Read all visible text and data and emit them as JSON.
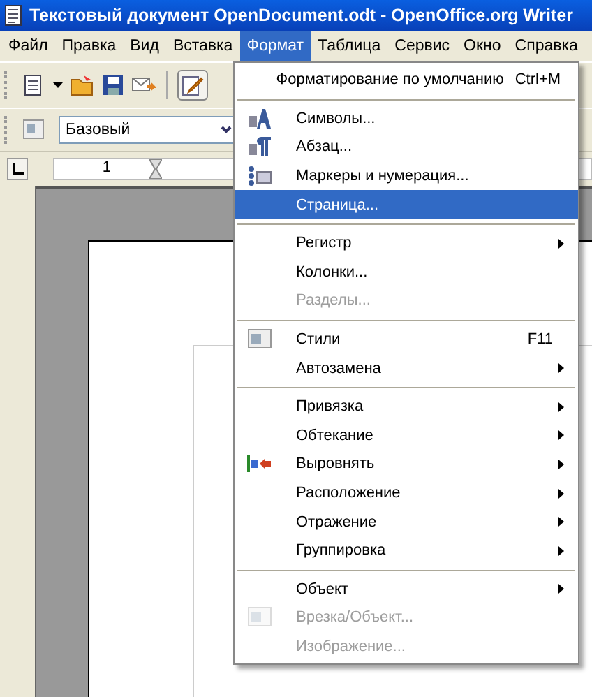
{
  "window": {
    "title": "Текстовый документ OpenDocument.odt - OpenOffice.org Writer"
  },
  "menubar": [
    {
      "label": "Файл",
      "selected": false
    },
    {
      "label": "Правка",
      "selected": false
    },
    {
      "label": "Вид",
      "selected": false
    },
    {
      "label": "Вставка",
      "selected": false
    },
    {
      "label": "Формат",
      "selected": true
    },
    {
      "label": "Таблица",
      "selected": false
    },
    {
      "label": "Сервис",
      "selected": false
    },
    {
      "label": "Окно",
      "selected": false
    },
    {
      "label": "Справка",
      "selected": false
    }
  ],
  "formatting_toolbar": {
    "paragraph_style": "Базовый"
  },
  "ruler": {
    "label": "1"
  },
  "format_menu": [
    {
      "kind": "item",
      "label": "Форматирование по умолчанию",
      "shortcut": "Ctrl+M",
      "submenu": false,
      "disabled": false,
      "selected": false
    },
    {
      "kind": "separator"
    },
    {
      "kind": "icon_item",
      "label": "Символы...",
      "submenu": false,
      "disabled": false,
      "selected": false
    },
    {
      "kind": "icon_item",
      "label": "Абзац...",
      "submenu": false,
      "disabled": false,
      "selected": false
    },
    {
      "kind": "icon_item",
      "label": "Маркеры и нумерация...",
      "submenu": false,
      "disabled": false,
      "selected": false
    },
    {
      "kind": "item",
      "label": "Страница...",
      "submenu": false,
      "disabled": false,
      "selected": true
    },
    {
      "kind": "separator"
    },
    {
      "kind": "item",
      "label": "Регистр",
      "submenu": true,
      "disabled": false,
      "selected": false
    },
    {
      "kind": "item",
      "label": "Колонки...",
      "submenu": false,
      "disabled": false,
      "selected": false
    },
    {
      "kind": "item",
      "label": "Разделы...",
      "submenu": false,
      "disabled": true,
      "selected": false
    },
    {
      "kind": "separator"
    },
    {
      "kind": "icon_item",
      "label": "Стили",
      "shortcut": "F11",
      "submenu": false,
      "disabled": false,
      "selected": false
    },
    {
      "kind": "item",
      "label": "Автозамена",
      "submenu": true,
      "disabled": false,
      "selected": false
    },
    {
      "kind": "separator"
    },
    {
      "kind": "item",
      "label": "Привязка",
      "submenu": true,
      "disabled": false,
      "selected": false
    },
    {
      "kind": "item",
      "label": "Обтекание",
      "submenu": true,
      "disabled": false,
      "selected": false
    },
    {
      "kind": "icon_item",
      "label": "Выровнять",
      "submenu": true,
      "disabled": false,
      "selected": false
    },
    {
      "kind": "item",
      "label": "Расположение",
      "submenu": true,
      "disabled": false,
      "selected": false
    },
    {
      "kind": "item",
      "label": "Отражение",
      "submenu": true,
      "disabled": false,
      "selected": false
    },
    {
      "kind": "item",
      "label": "Группировка",
      "submenu": true,
      "disabled": false,
      "selected": false
    },
    {
      "kind": "separator"
    },
    {
      "kind": "item",
      "label": "Объект",
      "submenu": true,
      "disabled": false,
      "selected": false
    },
    {
      "kind": "icon_item",
      "label": "Врезка/Объект...",
      "submenu": false,
      "disabled": true,
      "selected": false
    },
    {
      "kind": "item",
      "label": "Изображение...",
      "submenu": false,
      "disabled": true,
      "selected": false
    }
  ]
}
